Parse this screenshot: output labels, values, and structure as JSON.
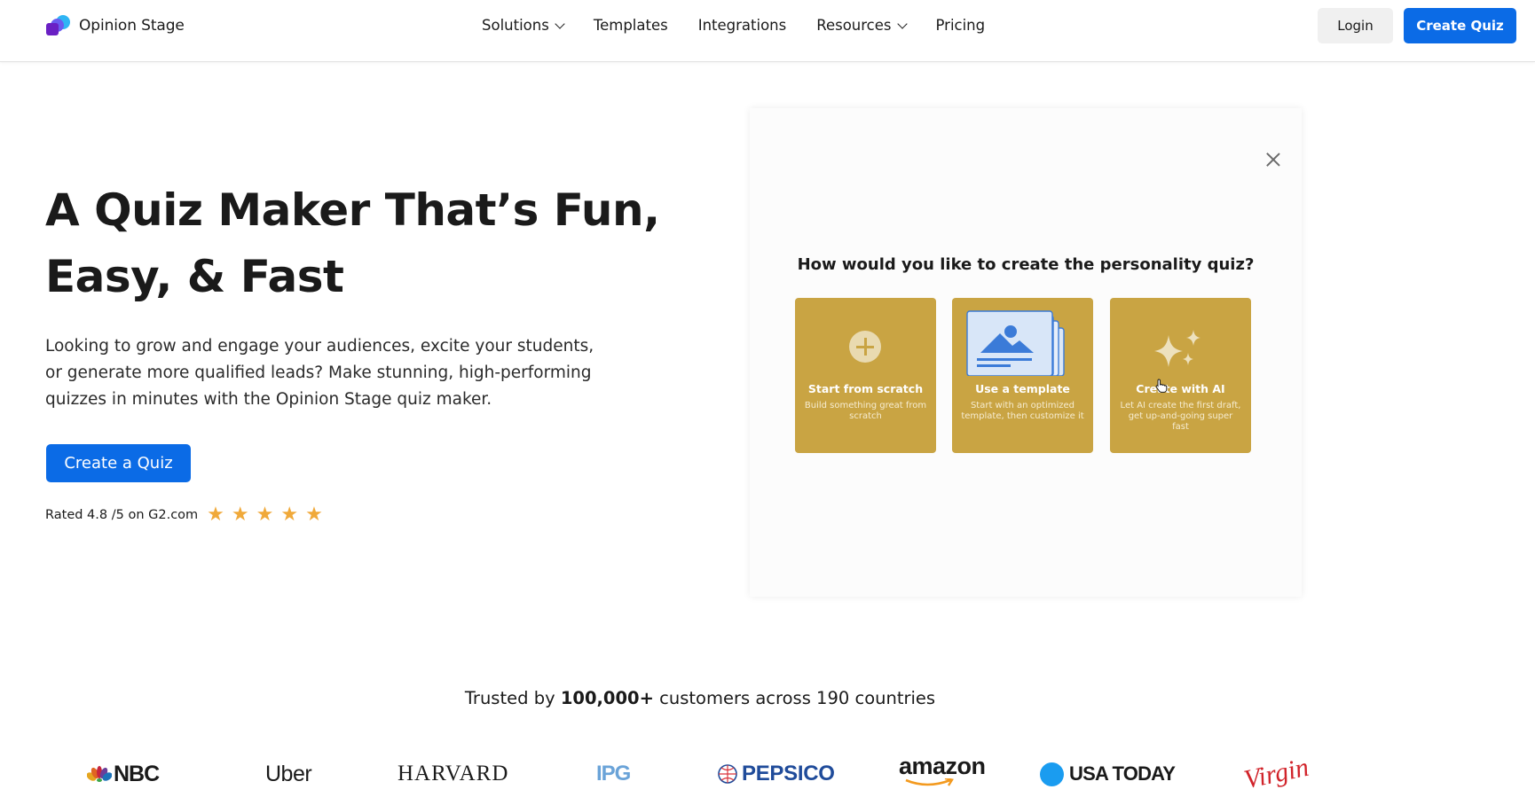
{
  "header": {
    "logo_text": "Opinion Stage",
    "nav": [
      {
        "label": "Solutions",
        "has_dropdown": true
      },
      {
        "label": "Templates",
        "has_dropdown": false
      },
      {
        "label": "Integrations",
        "has_dropdown": false
      },
      {
        "label": "Resources",
        "has_dropdown": true
      },
      {
        "label": "Pricing",
        "has_dropdown": false
      }
    ],
    "login_label": "Login",
    "create_quiz_label": "Create Quiz"
  },
  "hero": {
    "title_line1": "A Quiz Maker That’s Fun,",
    "title_line2": "Easy, & Fast",
    "description": "Looking to grow and engage your audiences, excite your students, or generate more qualified leads? Make stunning, high-performing quizzes in minutes with the Opinion Stage quiz maker.",
    "cta_label": "Create a Quiz",
    "rating_text": "Rated 4.8 /5 on G2.com",
    "rating_value": 4.8,
    "rating_max": 5,
    "stars": [
      "★",
      "★",
      "★",
      "★",
      "★"
    ]
  },
  "modal": {
    "title": "How would you like to create the personality quiz?",
    "options": [
      {
        "title": "Start from scratch",
        "description": "Build something great from scratch",
        "icon": "plus-circle-icon"
      },
      {
        "title": "Use a template",
        "description": "Start with an optimized template, then customize it",
        "icon": "template-image-icon"
      },
      {
        "title": "Create with AI",
        "description": "Let AI create the first draft, get up-and-going super fast",
        "icon": "sparkles-icon"
      }
    ]
  },
  "trusted": {
    "prefix": "Trusted by ",
    "highlight": "100,000+",
    "suffix": " customers across 190 countries"
  },
  "brands": [
    "NBC",
    "Uber",
    "HARVARD",
    "IPG",
    "PEPSICO",
    "amazon",
    "USA TODAY",
    "Virgin"
  ],
  "colors": {
    "primary": "#0b6be6",
    "option_card": "#c9a443",
    "star": "#f0a93a",
    "pepsico": "#1f4b9a",
    "virgin": "#d1232a",
    "usatoday": "#1a9cf0"
  }
}
